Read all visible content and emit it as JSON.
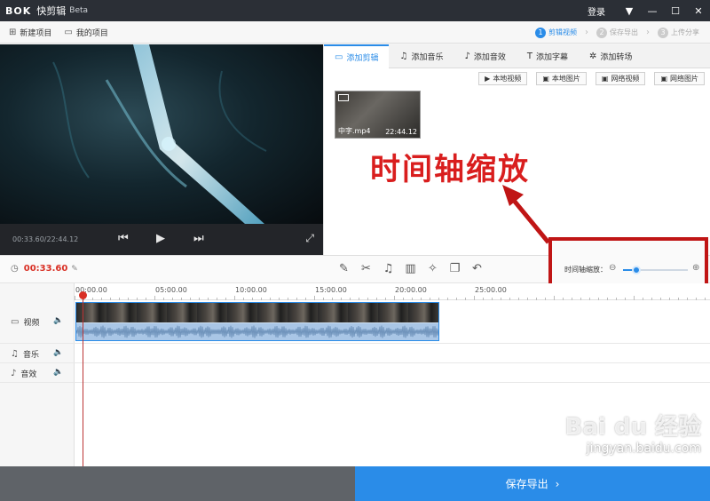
{
  "titlebar": {
    "logo": "BOK",
    "app_name": "快剪辑",
    "beta": "Beta",
    "login": "登录"
  },
  "menubar": {
    "new_project": "新建项目",
    "my_projects": "我的项目",
    "steps": [
      {
        "num": "1",
        "label": "剪辑视频"
      },
      {
        "num": "2",
        "label": "保存导出"
      },
      {
        "num": "3",
        "label": "上传分享"
      }
    ]
  },
  "preview": {
    "timecode": "00:33.60/22:44.12"
  },
  "panel": {
    "tabs": [
      "添加剪辑",
      "添加音乐",
      "添加音效",
      "添加字幕",
      "添加转场"
    ],
    "source_buttons": [
      "本地视频",
      "本地图片",
      "网络视频",
      "网络图片"
    ],
    "media": {
      "name": "中字.mp4",
      "duration": "22:44.12"
    },
    "annotation": "时间轴缩放"
  },
  "toolbar": {
    "current_time": "00:33.60",
    "zoom_label": "时间轴缩放：",
    "zoom_level": 0.2
  },
  "timeline": {
    "ticks": [
      "00:00.00",
      "05:00.00",
      "10:00.00",
      "15:00.00",
      "20:00.00",
      "25:00.00"
    ],
    "tracks": [
      "视频",
      "音乐",
      "音效"
    ]
  },
  "bottom": {
    "export": "保存导出"
  },
  "watermark": {
    "logo": "Bai du 经验",
    "url": "jingyan.baidu.com"
  }
}
